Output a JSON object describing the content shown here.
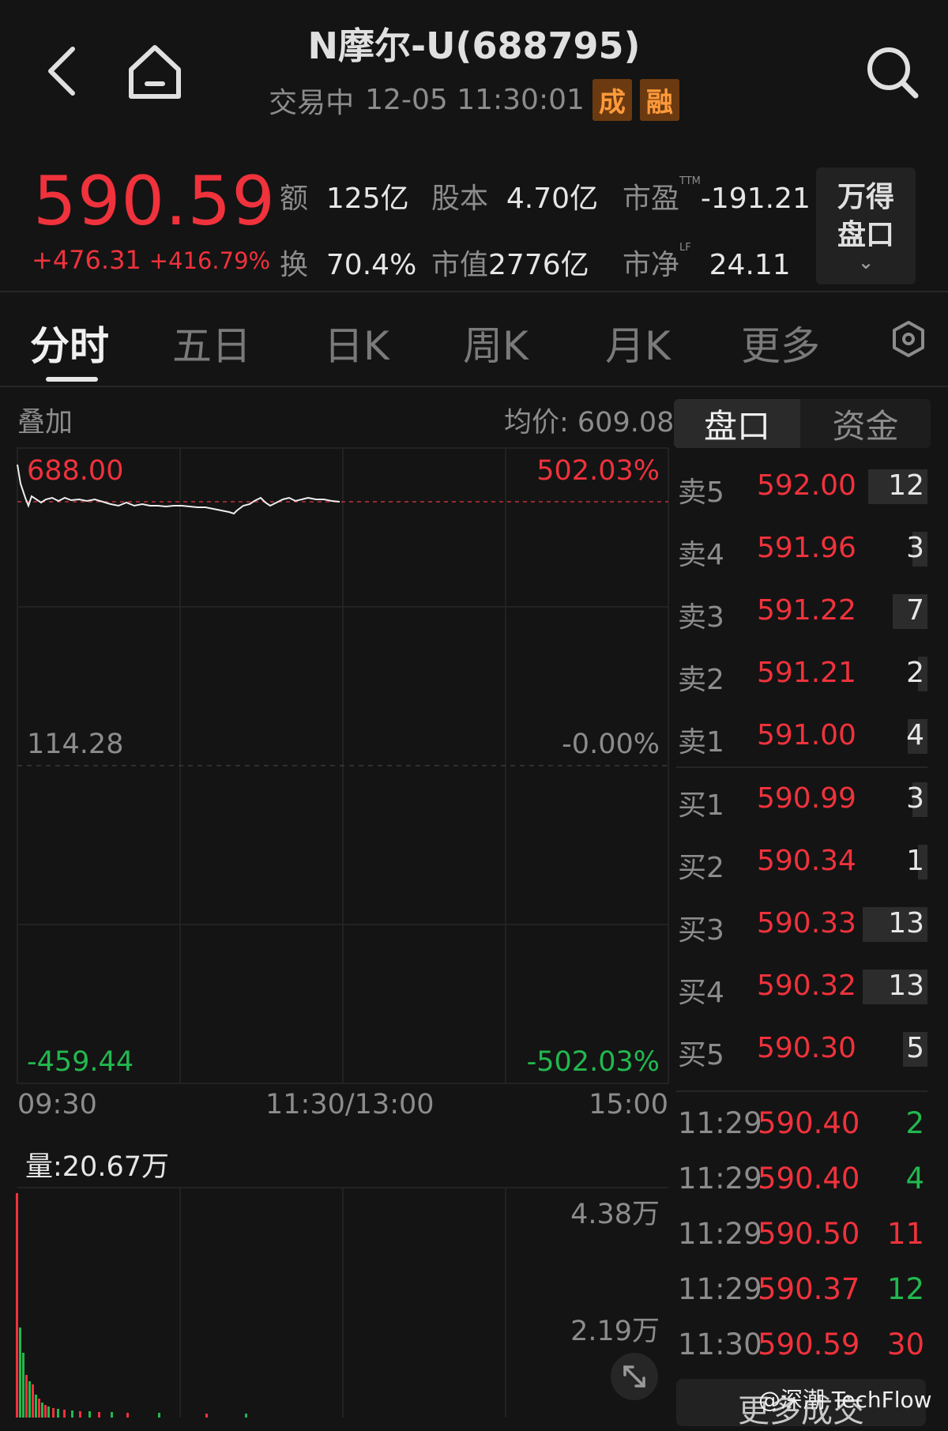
{
  "header": {
    "title": "N摩尔-U(688795)",
    "status": "交易中",
    "datetime": "12-05 11:30:01",
    "tags": [
      "成",
      "融"
    ]
  },
  "quote": {
    "price": "590.59",
    "change": "+476.31",
    "change_pct": "+416.79%",
    "stats": [
      {
        "key": "额",
        "value": "125亿"
      },
      {
        "key": "股本",
        "value": "4.70亿"
      },
      {
        "key": "市盈",
        "sup": "TTM",
        "value": "-191.21"
      },
      {
        "key": "换",
        "value": "70.4%"
      },
      {
        "key": "市值",
        "value": "2776亿"
      },
      {
        "key": "市净",
        "sup": "LF",
        "value": "24.11"
      }
    ],
    "wande_line1": "万得",
    "wande_line2": "盘口"
  },
  "tabs": [
    "分时",
    "五日",
    "日K",
    "周K",
    "月K",
    "更多"
  ],
  "chart": {
    "overlay_label": "叠加",
    "avg_price_label": "均价: 609.08",
    "y_top": "688.00",
    "y_top_pct": "502.03%",
    "y_mid": "114.28",
    "y_mid_pct": "-0.00%",
    "y_bottom": "-459.44",
    "y_bottom_pct": "-502.03%",
    "x_start": "09:30",
    "x_mid": "11:30/13:00",
    "x_end": "15:00",
    "volume_label": "量:20.67万",
    "vol_top": "4.38万",
    "vol_mid": "2.19万"
  },
  "panel": {
    "tabs": [
      "盘口",
      "资金"
    ],
    "asks": [
      {
        "label": "卖5",
        "price": "592.00",
        "qty": "12",
        "depth": 0.92
      },
      {
        "label": "卖4",
        "price": "591.96",
        "qty": "3",
        "depth": 0.23
      },
      {
        "label": "卖3",
        "price": "591.22",
        "qty": "7",
        "depth": 0.54
      },
      {
        "label": "卖2",
        "price": "591.21",
        "qty": "2",
        "depth": 0.15
      },
      {
        "label": "卖1",
        "price": "591.00",
        "qty": "4",
        "depth": 0.31
      }
    ],
    "bids": [
      {
        "label": "买1",
        "price": "590.99",
        "qty": "3",
        "depth": 0.23
      },
      {
        "label": "买2",
        "price": "590.34",
        "qty": "1",
        "depth": 0.08
      },
      {
        "label": "买3",
        "price": "590.33",
        "qty": "13",
        "depth": 1.0
      },
      {
        "label": "买4",
        "price": "590.32",
        "qty": "13",
        "depth": 1.0
      },
      {
        "label": "买5",
        "price": "590.30",
        "qty": "5",
        "depth": 0.38
      }
    ],
    "trades": [
      {
        "time": "11:29",
        "price": "590.40",
        "qty": "2",
        "side": "sell"
      },
      {
        "time": "11:29",
        "price": "590.40",
        "qty": "4",
        "side": "sell"
      },
      {
        "time": "11:29",
        "price": "590.50",
        "qty": "11",
        "side": "buy"
      },
      {
        "time": "11:29",
        "price": "590.37",
        "qty": "12",
        "side": "sell"
      },
      {
        "time": "11:30",
        "price": "590.59",
        "qty": "30",
        "side": "buy"
      }
    ],
    "more_label": "更多成交"
  },
  "watermark": "@深潮 TechFlow",
  "colors": {
    "up": "#f0323c",
    "down": "#22b84f",
    "background": "#141414",
    "tag_bg": "#6b3a10",
    "tag_fg": "#ff9a3a"
  }
}
